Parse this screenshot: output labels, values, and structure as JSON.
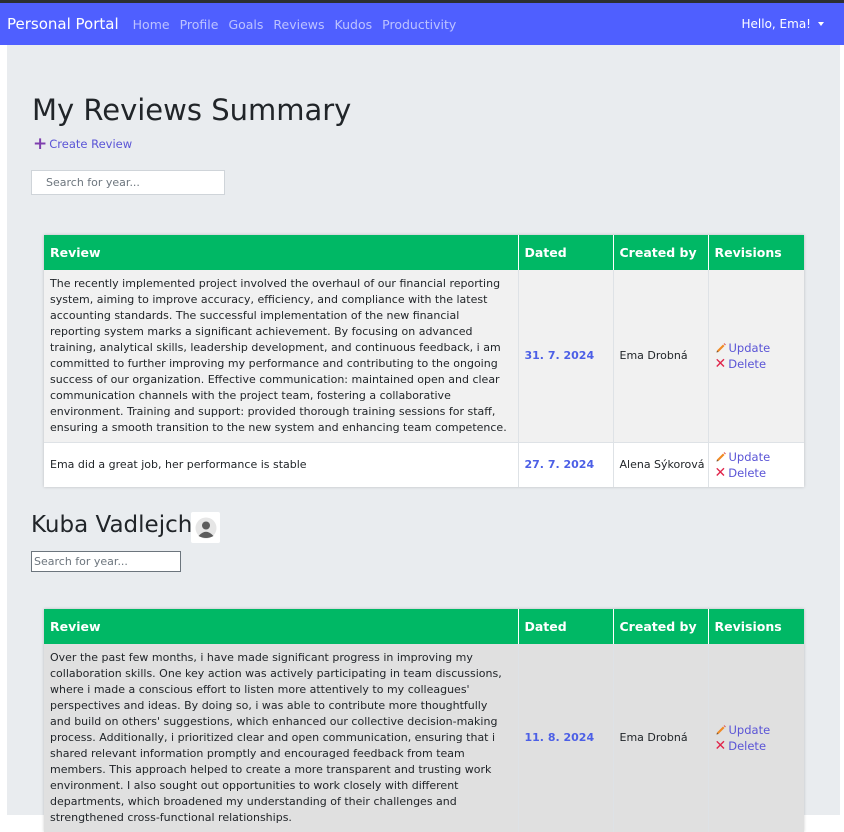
{
  "navbar": {
    "brand": "Personal Portal",
    "links": [
      "Home",
      "Profile",
      "Goals",
      "Reviews",
      "Kudos",
      "Productivity"
    ],
    "user_greeting": "Hello, Ema!"
  },
  "page": {
    "title": "My Reviews Summary",
    "create_label": "Create Review",
    "search_placeholder": "Search for year..."
  },
  "table_headers": [
    "Review",
    "Dated",
    "Created by",
    "Revisions"
  ],
  "actions": {
    "update": "Update",
    "delete": "Delete"
  },
  "my_reviews": [
    {
      "review": "The recently implemented project involved the overhaul of our financial reporting system, aiming to improve accuracy, efficiency, and compliance with the latest accounting standards. The successful implementation of the new financial reporting system marks a significant achievement. By focusing on advanced training, analytical skills, leadership development, and continuous feedback, i am committed to further improving my performance and contributing to the ongoing success of our organization. Effective communication: maintained open and clear communication channels with the project team, fostering a collaborative environment. Training and support: provided thorough training sessions for staff, ensuring a smooth transition to the new system and enhancing team competence.",
      "dated": "31. 7. 2024",
      "created_by": "Ema Drobná"
    },
    {
      "review": "Ema did a great job, her performance is stable",
      "dated": "27. 7. 2024",
      "created_by": "Alena Sýkorová"
    }
  ],
  "team_member": {
    "name": "Kuba Vadlejch",
    "search_placeholder": "Search for year...",
    "reviews": [
      {
        "review": "Over the past few months, i have made significant progress in improving my collaboration skills. One key action was actively participating in team discussions, where i made a conscious effort to listen more attentively to my colleagues' perspectives and ideas. By doing so, i was able to contribute more thoughtfully and build on others' suggestions, which enhanced our collective decision-making process. Additionally, i prioritized clear and open communication, ensuring that i shared relevant information promptly and encouraged feedback from team members. This approach helped to create a more transparent and trusting work environment. I also sought out opportunities to work closely with different departments, which broadened my understanding of their challenges and strengthened cross-functional relationships.",
        "dated": "11. 8. 2024",
        "created_by": "Ema Drobná"
      }
    ]
  },
  "colors": {
    "navbar": "#4f5fff",
    "table_header": "#00b865",
    "link": "#5a54d6",
    "date": "#4c5fe6",
    "delete": "#e0244a",
    "update_icon": "#f08a24"
  }
}
